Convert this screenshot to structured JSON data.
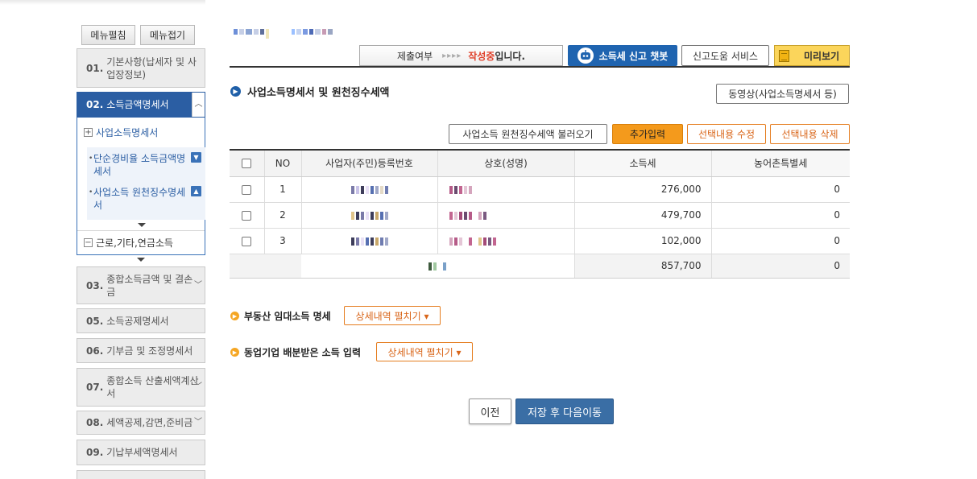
{
  "sidebar": {
    "expand_label": "메뉴펼침",
    "collapse_label": "메뉴접기",
    "items": [
      {
        "num": "01.",
        "label": "기본사항(납세자 및 사업장정보)"
      },
      {
        "num": "02.",
        "label": "소득금액명세서"
      },
      {
        "num": "03.",
        "label": "종합소득금액 및 결손금"
      },
      {
        "num": "05.",
        "label": "소득공제명세서"
      },
      {
        "num": "06.",
        "label": "기부금 및 조정명세서"
      },
      {
        "num": "07.",
        "label": "종합소득 산출세액계산서"
      },
      {
        "num": "08.",
        "label": "세액공제,감면,준비금"
      },
      {
        "num": "09.",
        "label": "기납부세액명세서"
      }
    ],
    "sub_business": "사업소득명세서",
    "leaf_expense": "단순경비율 소득금액명세서",
    "leaf_withholding": "사업소득 원천징수명세서",
    "sub_other": "근로,기타,연금소득"
  },
  "header": {
    "status_label": "제출여부",
    "status_arrows": "▸▸▸▸",
    "status_value": "작성중",
    "status_suffix": "입니다.",
    "chatbot_label": "소득세 신고 챗봇",
    "help_label": "신고도움 서비스",
    "preview_label": "미리보기"
  },
  "section": {
    "title": "사업소득명세서 및 원천징수세액",
    "video_button": "동영상(사업소득명세서 등)",
    "load_button": "사업소득 원천징수세액 불러오기",
    "add_button": "추가입력",
    "edit_button": "선택내용 수정",
    "delete_button": "선택내용 삭제"
  },
  "table": {
    "headers": [
      "NO",
      "사업자(주민)등록번호",
      "상호(성명)",
      "소득세",
      "농어촌특별세"
    ],
    "rows": [
      {
        "no": "1",
        "tax": "276,000",
        "rural": "0"
      },
      {
        "no": "2",
        "tax": "479,700",
        "rural": "0"
      },
      {
        "no": "3",
        "tax": "102,000",
        "rural": "0"
      }
    ],
    "total": {
      "tax": "857,700",
      "rural": "0"
    }
  },
  "details": {
    "rent_label": "부동산 임대소득 명세",
    "rent_button": "상세내역 펼치기 ▾",
    "coop_label": "동업기업 배분받은 소득 입력",
    "coop_button": "상세내역 펼치기 ▾"
  },
  "footer": {
    "prev_label": "이전",
    "next_label": "저장 후 다음이동"
  },
  "colors": {
    "primary_blue": "#2b5ea3",
    "accent_orange": "#f49a1c",
    "status_red": "#e0422c",
    "preview_yellow": "#fbd55b"
  }
}
